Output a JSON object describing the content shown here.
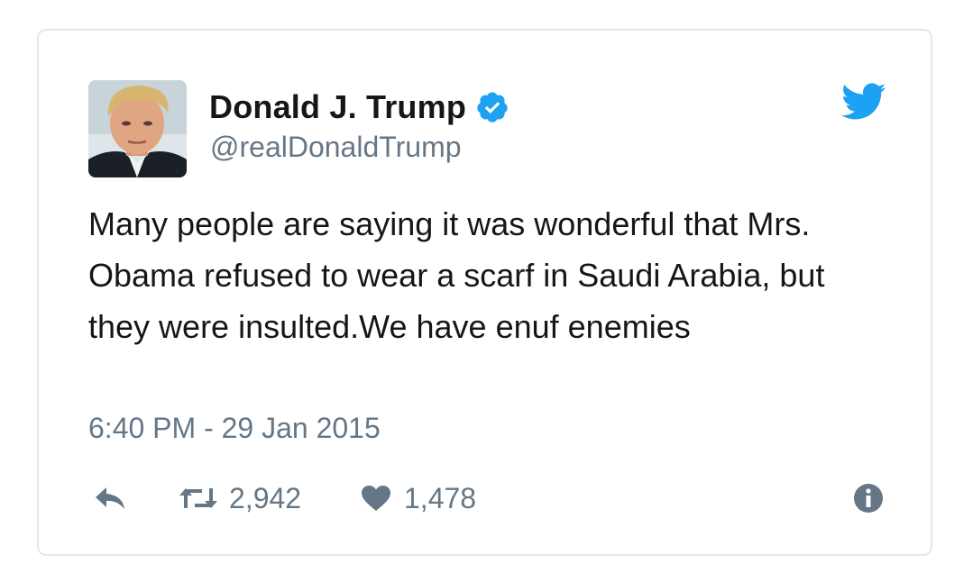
{
  "user": {
    "display_name": "Donald J. Trump",
    "handle": "@realDonaldTrump",
    "verified": true,
    "avatar_icon": "profile-photo"
  },
  "tweet": {
    "text": "Many people are saying it was wonderful that Mrs. Obama refused to wear a scarf in Saudi Arabia, but they were insulted.We have enuf enemies",
    "timestamp": "6:40 PM - 29 Jan 2015"
  },
  "actions": {
    "reply_icon": "reply-icon",
    "retweet_icon": "retweet-icon",
    "retweet_count": "2,942",
    "like_icon": "heart-icon",
    "like_count": "1,478",
    "info_icon": "info-icon"
  },
  "colors": {
    "text": "#14171a",
    "secondary": "#657786",
    "brand_blue": "#1da1f2",
    "border": "#e1e8ed"
  }
}
